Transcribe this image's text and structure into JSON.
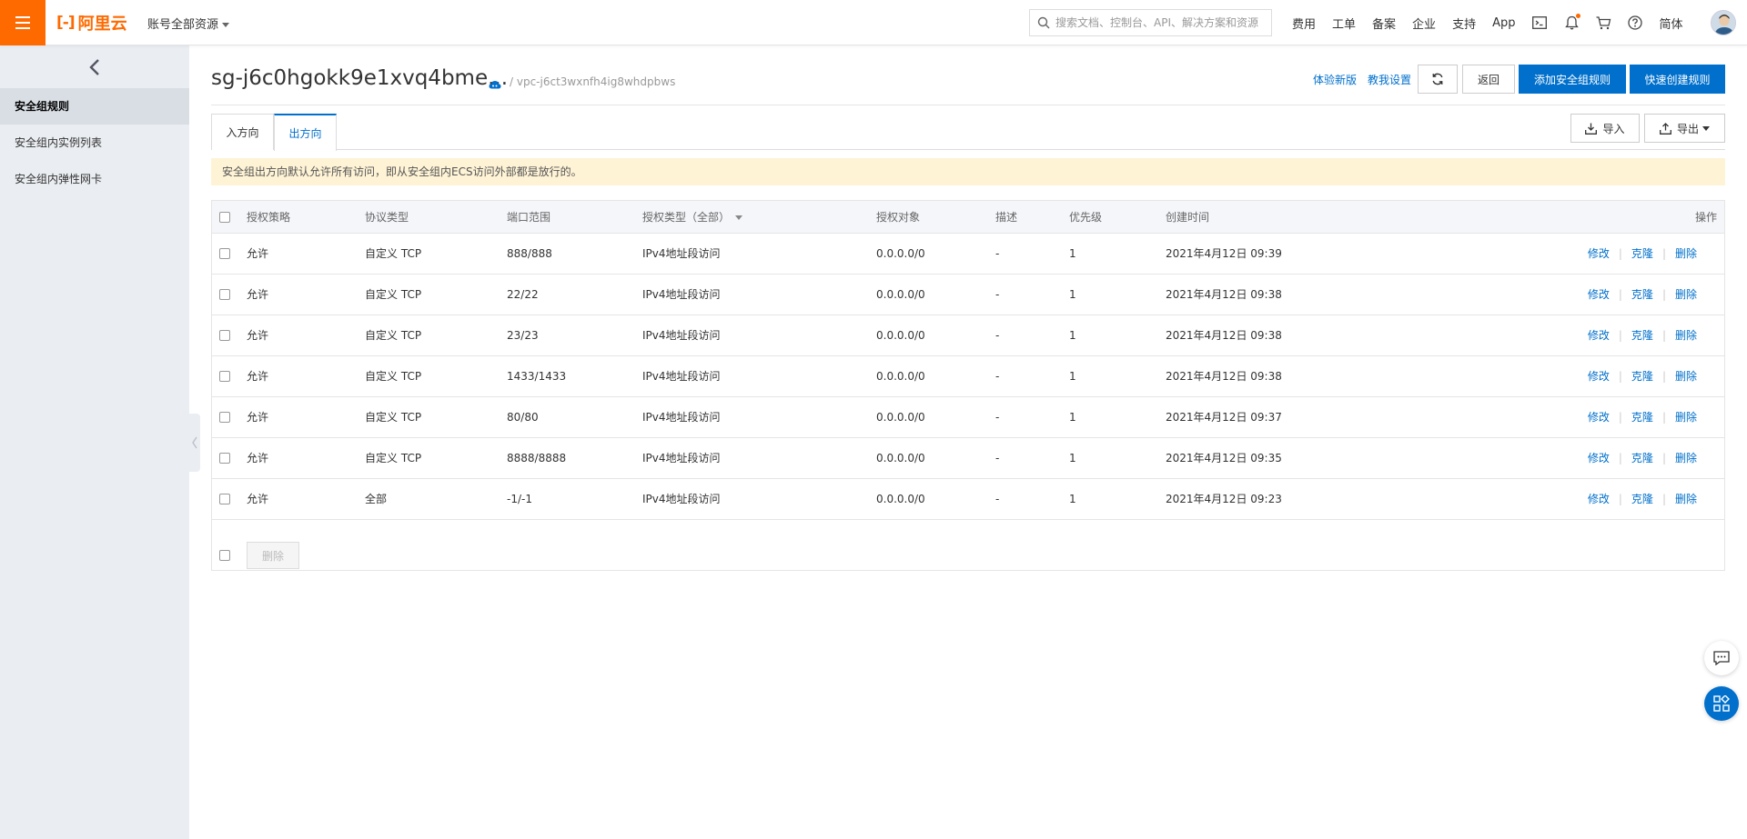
{
  "header": {
    "logo_text": "阿里云",
    "logo_mark": "[-]",
    "account_menu": "账号全部资源",
    "search_placeholder": "搜索文档、控制台、API、解决方案和资源",
    "nav_links": [
      "费用",
      "工单",
      "备案",
      "企业",
      "支持",
      "App"
    ],
    "lang": "简体"
  },
  "sidebar": {
    "items": [
      {
        "label": "安全组规则",
        "active": true
      },
      {
        "label": "安全组内实例列表",
        "active": false
      },
      {
        "label": "安全组内弹性网卡",
        "active": false
      }
    ]
  },
  "page": {
    "title": "sg-j6c0hgokk9e1xvq4bme...",
    "vpc": "/ vpc-j6ct3wxnfh4ig8whdpbws",
    "links": {
      "try_new": "体验新版",
      "teach_me": "教我设置"
    },
    "buttons": {
      "back": "返回",
      "add_rule": "添加安全组规则",
      "quick_create": "快速创建规则",
      "import": "导入",
      "export": "导出"
    },
    "tabs": [
      {
        "label": "入方向",
        "active": false
      },
      {
        "label": "出方向",
        "active": true
      }
    ],
    "notice": "安全组出方向默认允许所有访问，即从安全组内ECS访问外部都是放行的。"
  },
  "table": {
    "columns": {
      "policy": "授权策略",
      "protocol": "协议类型",
      "port": "端口范围",
      "auth_type": "授权类型（全部）",
      "target": "授权对象",
      "desc": "描述",
      "priority": "优先级",
      "created": "创建时间",
      "ops": "操作"
    },
    "rows": [
      {
        "policy": "允许",
        "protocol": "自定义 TCP",
        "port": "888/888",
        "auth_type": "IPv4地址段访问",
        "target": "0.0.0.0/0",
        "desc": "-",
        "priority": "1",
        "created": "2021年4月12日 09:39"
      },
      {
        "policy": "允许",
        "protocol": "自定义 TCP",
        "port": "22/22",
        "auth_type": "IPv4地址段访问",
        "target": "0.0.0.0/0",
        "desc": "-",
        "priority": "1",
        "created": "2021年4月12日 09:38"
      },
      {
        "policy": "允许",
        "protocol": "自定义 TCP",
        "port": "23/23",
        "auth_type": "IPv4地址段访问",
        "target": "0.0.0.0/0",
        "desc": "-",
        "priority": "1",
        "created": "2021年4月12日 09:38"
      },
      {
        "policy": "允许",
        "protocol": "自定义 TCP",
        "port": "1433/1433",
        "auth_type": "IPv4地址段访问",
        "target": "0.0.0.0/0",
        "desc": "-",
        "priority": "1",
        "created": "2021年4月12日 09:38"
      },
      {
        "policy": "允许",
        "protocol": "自定义 TCP",
        "port": "80/80",
        "auth_type": "IPv4地址段访问",
        "target": "0.0.0.0/0",
        "desc": "-",
        "priority": "1",
        "created": "2021年4月12日 09:37"
      },
      {
        "policy": "允许",
        "protocol": "自定义 TCP",
        "port": "8888/8888",
        "auth_type": "IPv4地址段访问",
        "target": "0.0.0.0/0",
        "desc": "-",
        "priority": "1",
        "created": "2021年4月12日 09:35"
      },
      {
        "policy": "允许",
        "protocol": "全部",
        "port": "-1/-1",
        "auth_type": "IPv4地址段访问",
        "target": "0.0.0.0/0",
        "desc": "-",
        "priority": "1",
        "created": "2021年4月12日 09:23"
      }
    ],
    "row_ops": {
      "edit": "修改",
      "clone": "克隆",
      "delete": "删除"
    },
    "footer_delete": "删除"
  },
  "colors": {
    "brand": "#ff6a00",
    "primary": "#0070cc",
    "notice_bg": "#fff3d6",
    "sidebar_bg": "#eaedf1"
  },
  "icons": [
    "menu-icon",
    "search-icon",
    "terminal-icon",
    "bell-icon",
    "cart-icon",
    "help-icon",
    "chevron-left-icon",
    "cloud-icon",
    "refresh-icon",
    "download-icon",
    "upload-icon",
    "chat-icon",
    "apps-icon"
  ]
}
